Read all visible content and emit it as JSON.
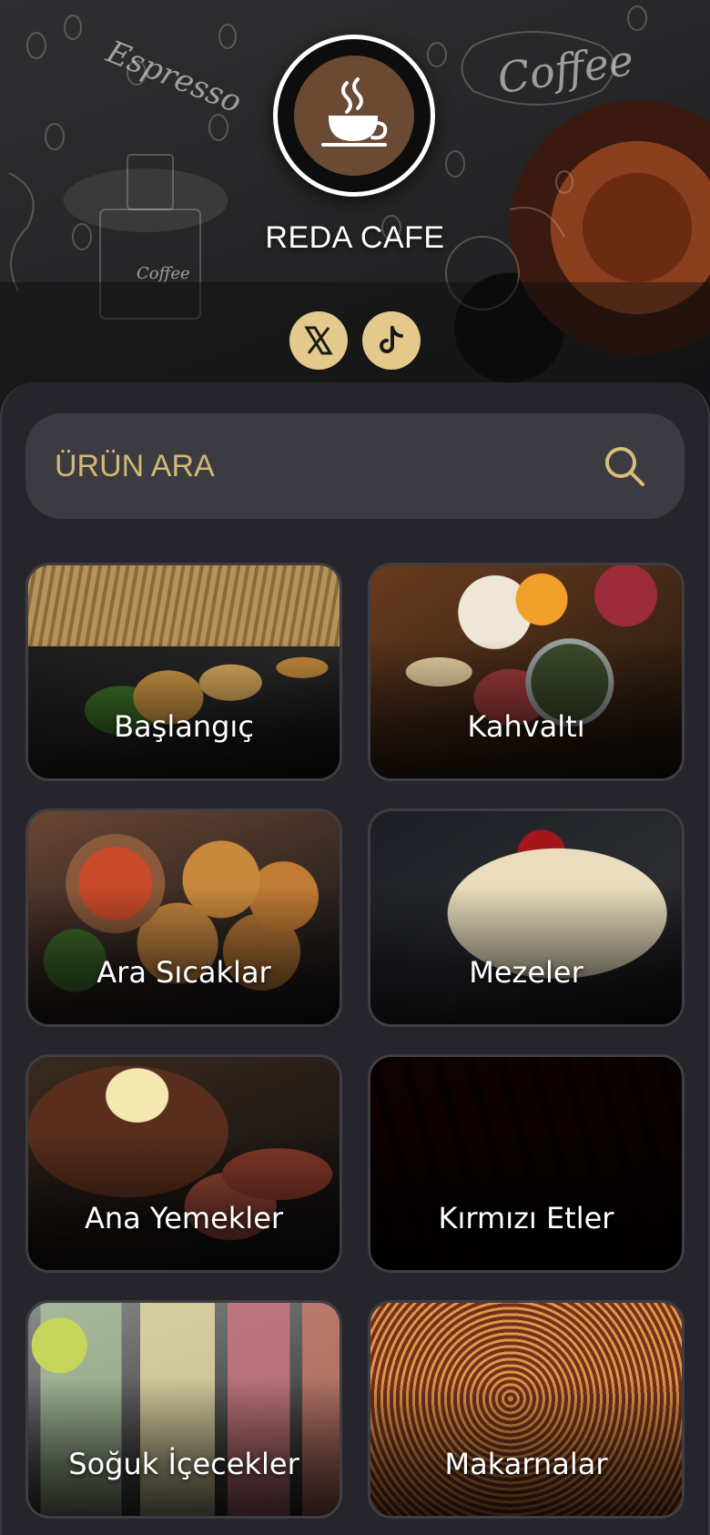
{
  "brand": {
    "name": "REDA CAFE",
    "logo_icon": "coffee-cup-icon"
  },
  "social": [
    {
      "name": "x-twitter",
      "icon": "x-icon",
      "glyph": "𝕏"
    },
    {
      "name": "tiktok",
      "icon": "tiktok-icon",
      "glyph": "♪"
    }
  ],
  "search": {
    "placeholder": "ÜRÜN ARA",
    "value": "",
    "icon": "search-icon"
  },
  "colors": {
    "accent": "#e3c98b",
    "search_text": "#d2b776",
    "panel": "#25252b",
    "search_bg": "#3c3b41"
  },
  "categories": [
    {
      "label": "Başlangıç"
    },
    {
      "label": "Kahvaltı"
    },
    {
      "label": "Ara Sıcaklar"
    },
    {
      "label": "Mezeler"
    },
    {
      "label": "Ana Yemekler"
    },
    {
      "label": "Kırmızı Etler"
    },
    {
      "label": "Soğuk İçecekler"
    },
    {
      "label": "Makarnalar"
    }
  ]
}
